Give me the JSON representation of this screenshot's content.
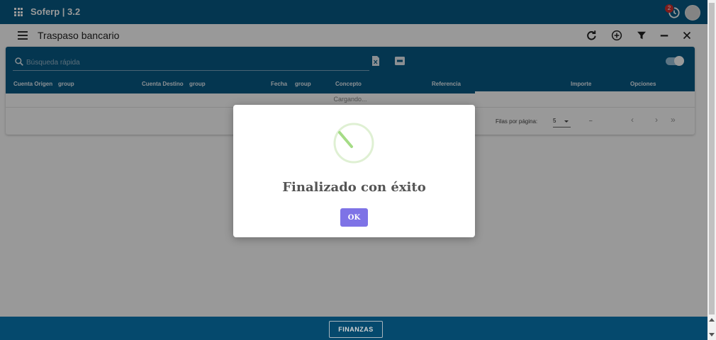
{
  "app": {
    "title": "Soferp | 3.2",
    "notification_count": "2"
  },
  "page": {
    "title": "Traspaso bancario"
  },
  "toolbar_icons": [
    "refresh-icon",
    "add-circle-icon",
    "filter-icon",
    "minimize-icon",
    "close-icon"
  ],
  "search": {
    "placeholder": "Búsqueda rápida"
  },
  "table": {
    "columns": [
      {
        "label": "Cuenta Origen"
      },
      {
        "label": "group"
      },
      {
        "label": "Cuenta Destino"
      },
      {
        "label": "group"
      },
      {
        "label": "Fecha"
      },
      {
        "label": "group"
      },
      {
        "label": "Concepto"
      },
      {
        "label": "Referencia"
      },
      {
        "label": "Importe"
      },
      {
        "label": "Opciones"
      }
    ],
    "loading_text": "Cargando..."
  },
  "pagination": {
    "rows_label": "Filas por página:",
    "rows_value": "5",
    "range": "–"
  },
  "dialog": {
    "title": "Finalizado con éxito",
    "ok_label": "OK"
  },
  "footer": {
    "module_label": "FINANZAS"
  },
  "colors": {
    "primary": "#075a86",
    "dialog_button": "#7e73e6",
    "success": "#a5dc86",
    "badge": "#d32f2f"
  }
}
